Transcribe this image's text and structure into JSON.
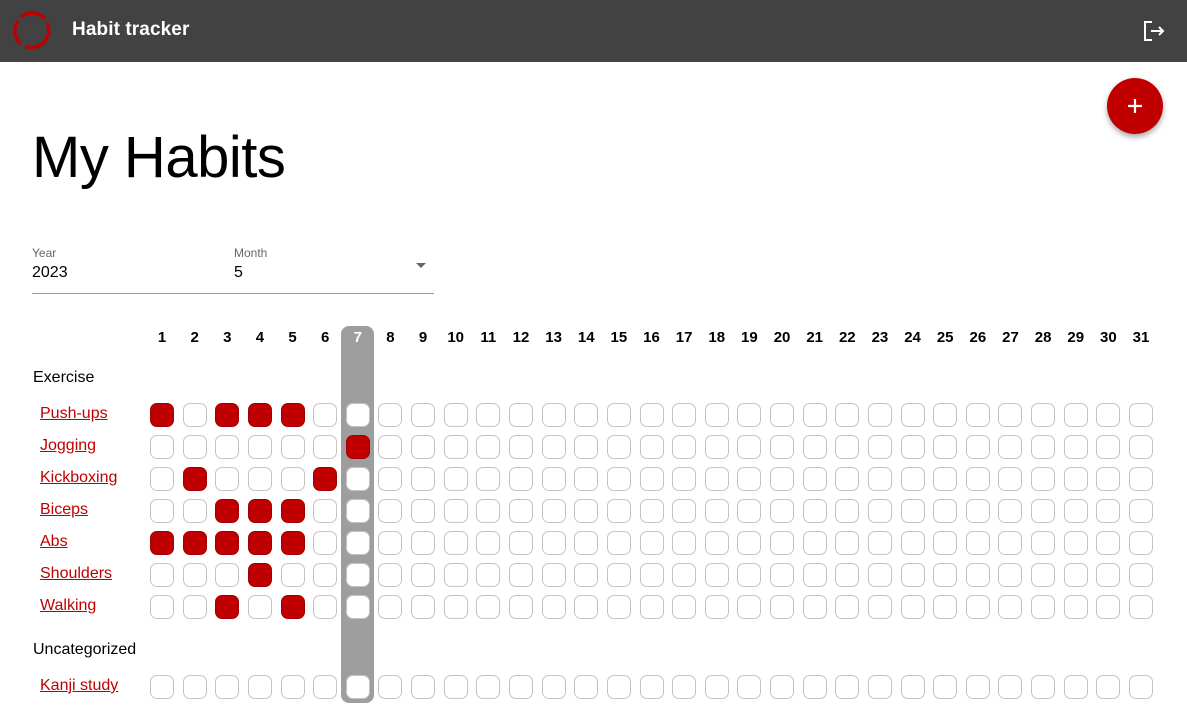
{
  "header": {
    "title": "Habit tracker",
    "logo_icon": "red-ring-logo",
    "logout_icon": "logout-icon"
  },
  "page_title": "My Habits",
  "add_button": {
    "icon": "plus-icon"
  },
  "filters": {
    "year_label": "Year",
    "year_value": "2023",
    "month_label": "Month",
    "month_value": "5"
  },
  "colors": {
    "accent": "#c00000",
    "header_bg": "#424242",
    "today_bg": "#9e9e9e"
  },
  "days": [
    "1",
    "2",
    "3",
    "4",
    "5",
    "6",
    "7",
    "8",
    "9",
    "10",
    "11",
    "12",
    "13",
    "14",
    "15",
    "16",
    "17",
    "18",
    "19",
    "20",
    "21",
    "22",
    "23",
    "24",
    "25",
    "26",
    "27",
    "28",
    "29",
    "30",
    "31"
  ],
  "current_day": 7,
  "categories": [
    {
      "name": "Exercise",
      "habits": [
        {
          "name": "Push-ups",
          "checked": [
            1,
            3,
            4,
            5
          ]
        },
        {
          "name": "Jogging",
          "checked": [
            7
          ]
        },
        {
          "name": "Kickboxing",
          "checked": [
            2,
            6
          ]
        },
        {
          "name": "Biceps",
          "checked": [
            3,
            4,
            5
          ]
        },
        {
          "name": "Abs",
          "checked": [
            1,
            2,
            3,
            4,
            5
          ]
        },
        {
          "name": "Shoulders",
          "checked": [
            4
          ]
        },
        {
          "name": "Walking",
          "checked": [
            3,
            5
          ]
        }
      ]
    },
    {
      "name": "Uncategorized",
      "habits": [
        {
          "name": "Kanji study",
          "checked": []
        }
      ]
    }
  ]
}
